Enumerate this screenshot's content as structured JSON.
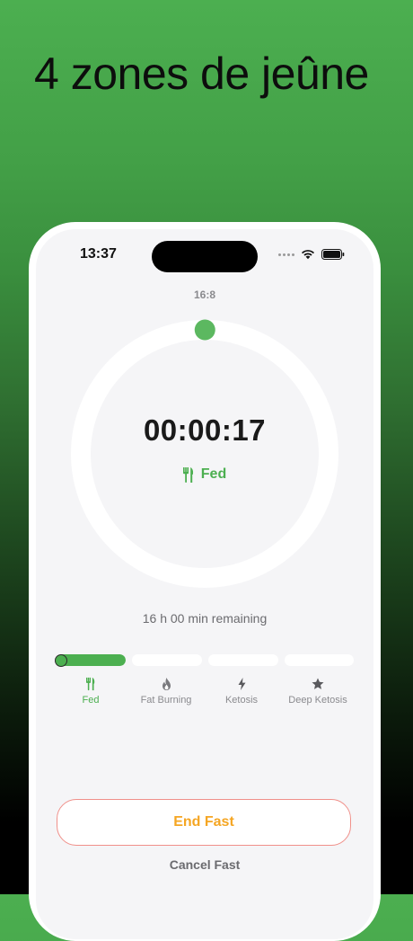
{
  "headline": "4 zones de jeûne",
  "status_bar": {
    "time": "13:37",
    "icons": [
      "signal-dots-icon",
      "wifi-icon",
      "battery-icon"
    ]
  },
  "fasting": {
    "plan": "16:8",
    "timer": "00:00:17",
    "current_zone": "Fed",
    "current_zone_icon": "fork-knife-icon",
    "remaining": "16 h 00 min remaining",
    "progress": 0.0003
  },
  "zones": [
    {
      "label": "Fed",
      "icon": "fork-knife-icon",
      "active": true,
      "fill": 1.0
    },
    {
      "label": "Fat Burning",
      "icon": "flame-icon",
      "active": false,
      "fill": 0
    },
    {
      "label": "Ketosis",
      "icon": "lightning-icon",
      "active": false,
      "fill": 0
    },
    {
      "label": "Deep Ketosis",
      "icon": "star-icon",
      "active": false,
      "fill": 0
    }
  ],
  "actions": {
    "end_label": "End Fast",
    "cancel_label": "Cancel Fast"
  },
  "colors": {
    "accent": "#4caf50",
    "end_text": "#f5a623",
    "end_border": "#f0908a"
  }
}
